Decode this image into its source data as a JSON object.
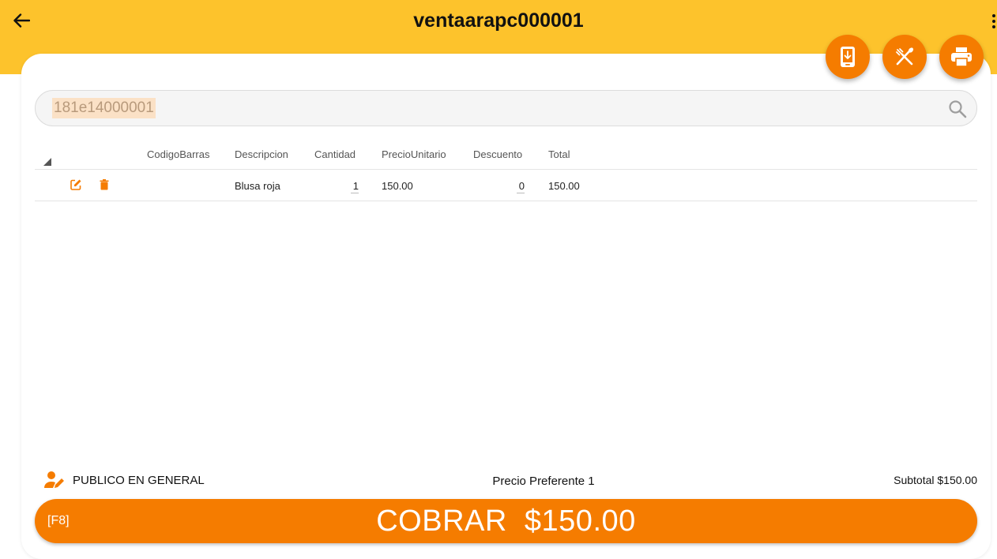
{
  "header": {
    "title": "ventaarapc000001",
    "back_icon": "arrow-left-icon",
    "menu_icon": "more-vertical-icon"
  },
  "fab_buttons": [
    {
      "icon": "phone-download-icon"
    },
    {
      "icon": "fork-knife-icon"
    },
    {
      "icon": "printer-icon"
    }
  ],
  "search": {
    "value": "181e14000001",
    "icon": "search-icon"
  },
  "table": {
    "columns": [
      "CodigoBarras",
      "Descripcion",
      "Cantidad",
      "PrecioUnitario",
      "Descuento",
      "Total"
    ],
    "rows": [
      {
        "codigo_barras": "",
        "descripcion": "Blusa roja",
        "cantidad": "1",
        "precio_unitario": "150.00",
        "descuento": "0",
        "total": "150.00"
      }
    ]
  },
  "footer": {
    "customer": "PUBLICO EN GENERAL",
    "price_level": "Precio Preferente 1",
    "subtotal": "Subtotal $150.00"
  },
  "charge": {
    "shortcut": "[F8]",
    "label": "COBRAR  $150.00"
  },
  "colors": {
    "header_bg": "#fdc32c",
    "accent": "#f57c00"
  }
}
